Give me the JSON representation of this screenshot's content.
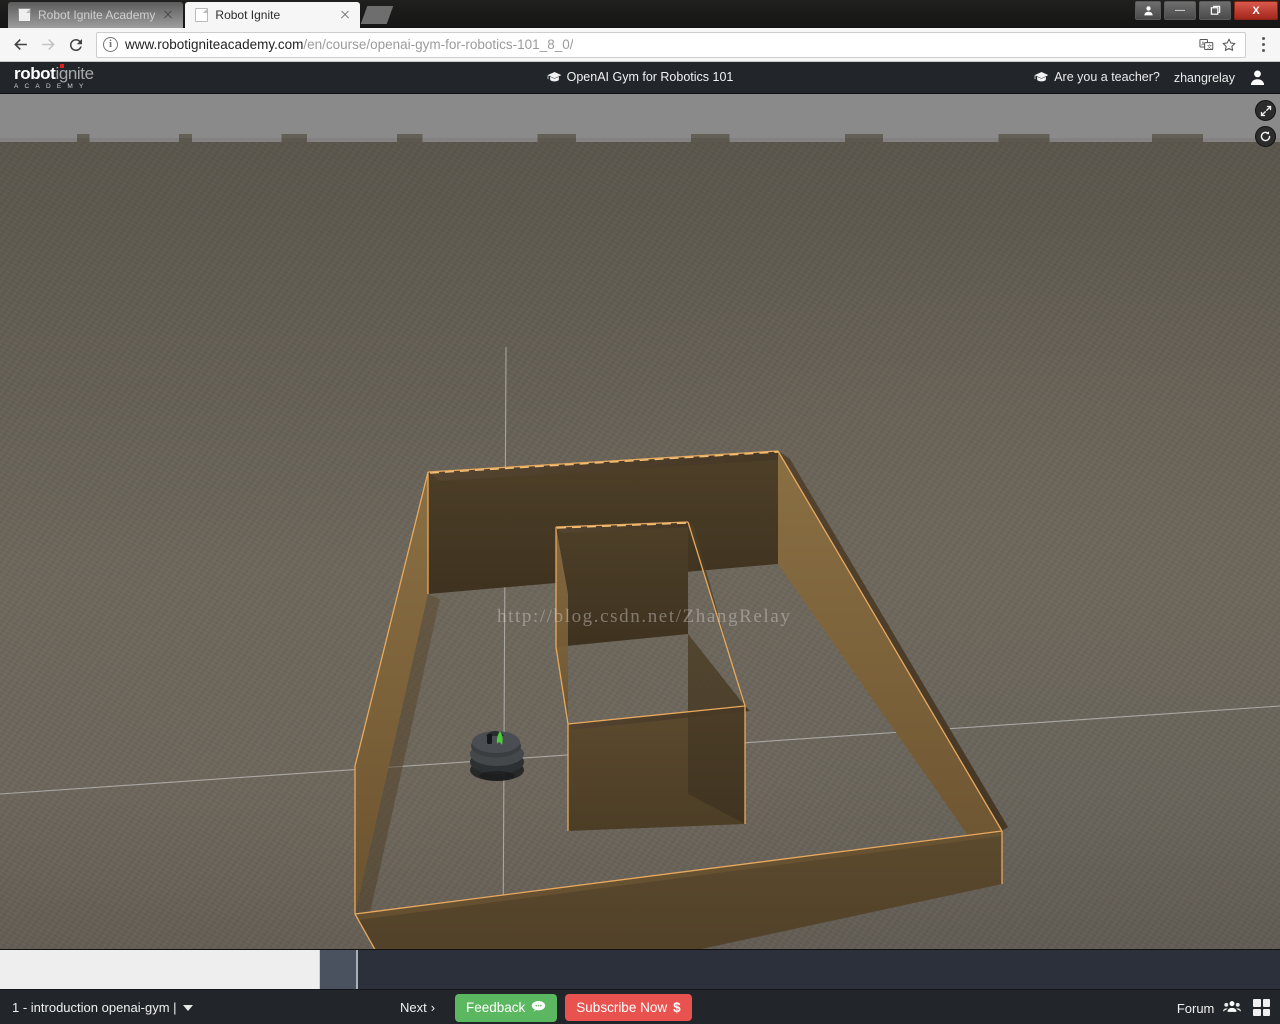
{
  "browser": {
    "tabs": [
      {
        "title": "Robot Ignite Academy",
        "active": false
      },
      {
        "title": "Robot Ignite",
        "active": true
      }
    ],
    "url_host": "www.robotigniteacademy.com",
    "url_path": "/en/course/openai-gym-for-robotics-101_8_0/",
    "back_icon": "back-arrow-icon",
    "forward_icon": "forward-arrow-icon",
    "reload_icon": "reload-icon",
    "info_icon": "i",
    "translate_icon": "translate-icon",
    "bookmark_icon": "star-icon",
    "menu_icon": "three-dot-menu-icon",
    "window": {
      "user_icon": "user-icon",
      "minimize": "—",
      "maximize": "❐",
      "close": "X"
    }
  },
  "site_header": {
    "logo_primary": "robot",
    "logo_secondary": "ignite",
    "logo_sub": "ACADEMY",
    "course_title": "OpenAI Gym for Robotics 101",
    "teacher_link": "Are you a teacher?",
    "username": "zhangrelay",
    "cap_icon": "graduation-cap-icon",
    "avatar_icon": "user-avatar-icon"
  },
  "simulation": {
    "watermark": "http://blog.csdn.net/ZhangRelay",
    "tools": [
      {
        "name": "fullscreen-icon",
        "glyph": "⤡"
      },
      {
        "name": "reset-icon",
        "glyph": "↺"
      }
    ],
    "colors": {
      "sky": "#8a8a8a",
      "ground": "#6a655c",
      "wall": "#6b5636",
      "wall_top": "#4a3c26",
      "wall_outline": "#e0a860",
      "robot_body": "#3a3d3f",
      "robot_marker": "#4ccc3a",
      "grid_line": "#d8d8d8"
    }
  },
  "footer": {
    "lesson_label": "1 - introduction openai-gym |",
    "next_label": "Next",
    "next_chevron": "›",
    "feedback_label": "Feedback",
    "feedback_icon": "speech-bubble-icon",
    "subscribe_label": "Subscribe Now",
    "subscribe_symbol": "$",
    "forum_label": "Forum",
    "forum_icon": "people-group-icon",
    "layout_icon": "grid-layout-icon"
  }
}
